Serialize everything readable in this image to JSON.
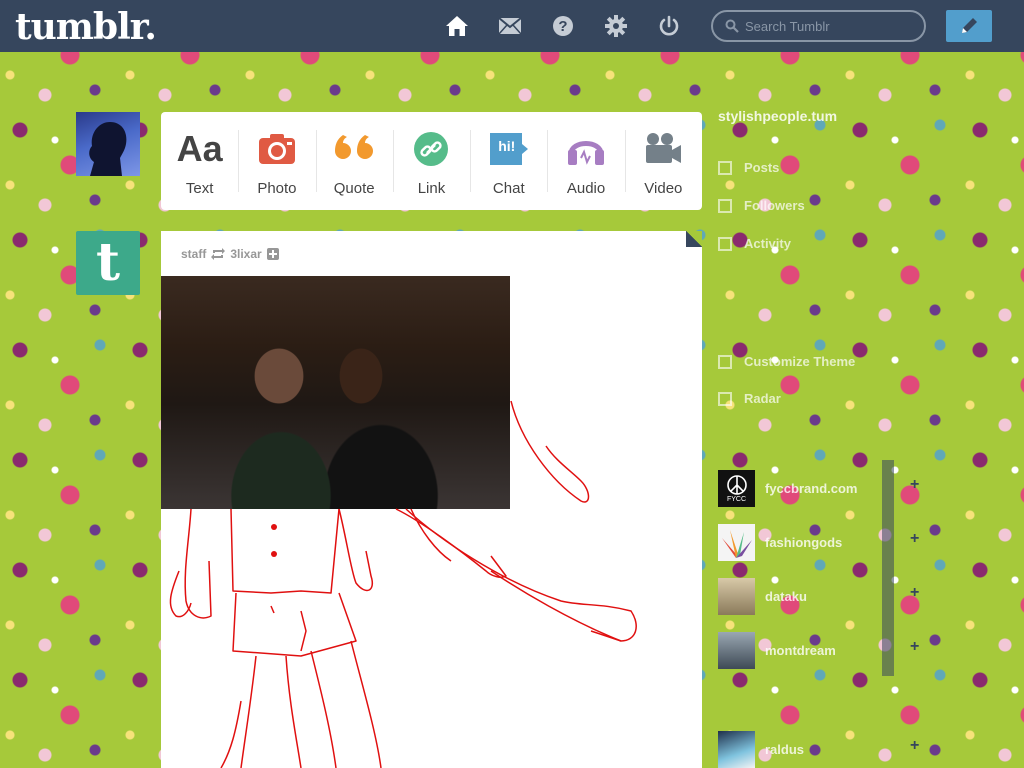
{
  "app": {
    "logo": "tumblr."
  },
  "nav": {
    "home_icon": "home-icon",
    "inbox_icon": "envelope-icon",
    "help_icon": "question-icon",
    "settings_icon": "gear-icon",
    "logout_icon": "power-icon"
  },
  "search": {
    "placeholder": "Search Tumblr"
  },
  "compose": {
    "icon": "pencil-icon"
  },
  "post_types": {
    "text": "Text",
    "photo": "Photo",
    "quote": "Quote",
    "link": "Link",
    "chat": "Chat",
    "chat_badge": "hi!",
    "audio": "Audio",
    "video": "Video"
  },
  "staff_avatar": {
    "letter": "t"
  },
  "post": {
    "author": "staff",
    "reblogged_from": "3lixar",
    "reblog_icon": "reblog-icon",
    "follow_icon": "plus-icon"
  },
  "sidebar": {
    "blog_title": "stylishpeople.tum",
    "nav": {
      "posts": "Posts",
      "followers": "Followers",
      "activity": "Activity",
      "customize": "Customize Theme",
      "radar": "Radar"
    },
    "recommended": [
      {
        "name": "fyccbrand.com",
        "avatar_text": "FYCC",
        "bg": "#111111"
      },
      {
        "name": "fashiongods",
        "avatar_text": "",
        "bg": "#f4f4f4"
      },
      {
        "name": "dataku",
        "avatar_text": "",
        "bg": "#c9b693"
      },
      {
        "name": "montdream",
        "avatar_text": "",
        "bg": "#6c7a86"
      },
      {
        "name": "raldus",
        "avatar_text": "",
        "bg": "#1f2f4a"
      }
    ]
  },
  "colors": {
    "topbar": "#36465d",
    "accent_blue": "#529ecc",
    "photo_red": "#e05a43",
    "quote_orange": "#f2992e",
    "link_green": "#56bc8a",
    "chat_blue": "#529ecc",
    "audio_purple": "#a77dc2",
    "video_gray": "#748089",
    "sketch_red": "#e01010"
  }
}
